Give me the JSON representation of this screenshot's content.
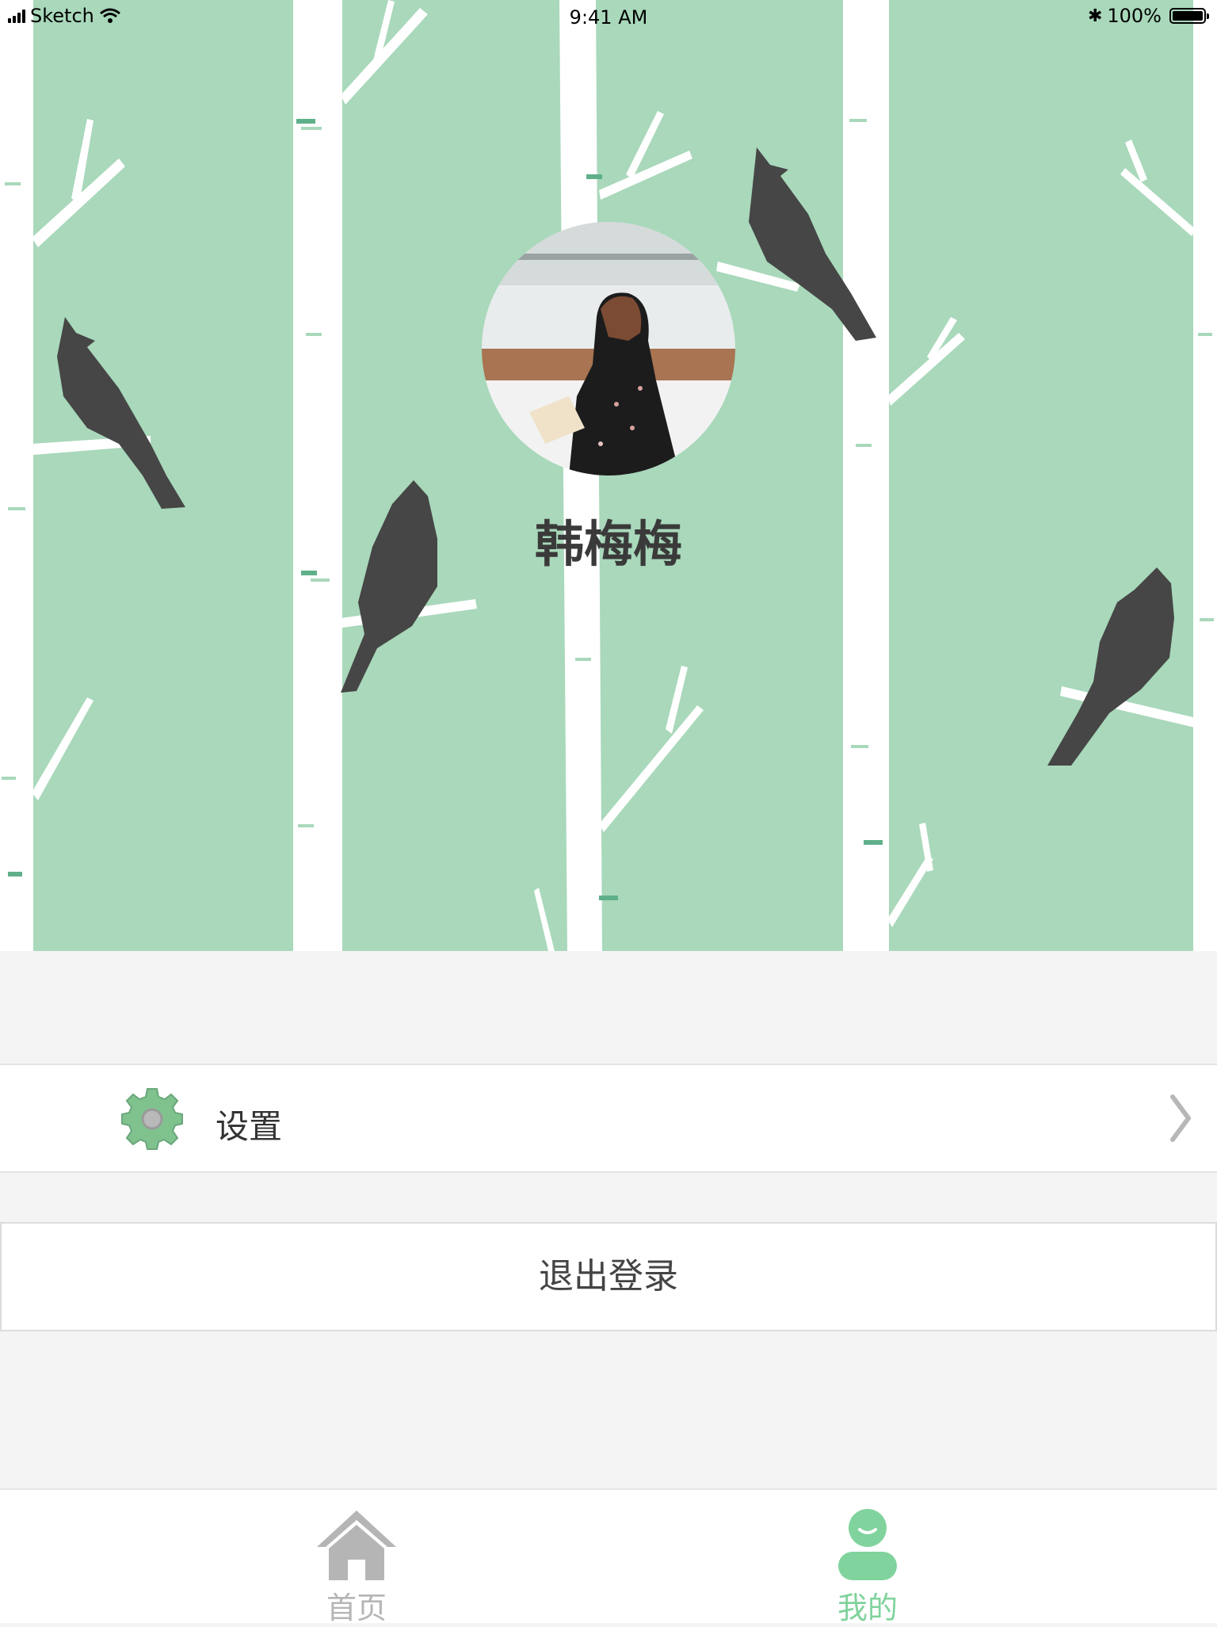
{
  "status_bar": {
    "carrier": "Sketch",
    "time": "9:41 AM",
    "battery": "100%"
  },
  "profile": {
    "name": "韩梅梅",
    "avatar_icon": "user-photo"
  },
  "menu": {
    "settings_label": "设置",
    "settings_icon": "gear-icon",
    "chevron_icon": "chevron-right-icon"
  },
  "logout_label": "退出登录",
  "tabbar": {
    "items": [
      {
        "label": "首页",
        "icon": "home-icon",
        "active": false
      },
      {
        "label": "我的",
        "icon": "user-icon",
        "active": true
      }
    ]
  },
  "colors": {
    "accent": "#80d39d",
    "hero_bg": "#a9d8bb",
    "tree": "#ffffff",
    "bird": "#464646",
    "page_bg": "#f4f4f4",
    "inactive": "#b5b5b5"
  }
}
